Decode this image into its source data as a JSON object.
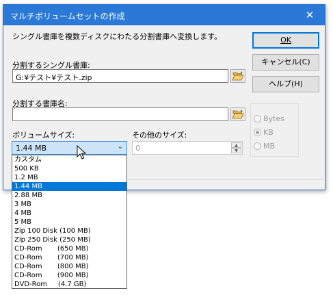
{
  "window": {
    "title": "マルチボリュームセットの作成",
    "close_glyph": "✕"
  },
  "instruction": "シングル書庫を複数ディスクにわたる分割書庫へ変換します。",
  "buttons": {
    "ok": "OK",
    "cancel": "キャンセル(C)",
    "help": "ヘルプ(H)"
  },
  "source": {
    "label": "分割するシングル書庫:",
    "value": "G:¥テスト¥テスト.zip"
  },
  "target": {
    "label": "分割する書庫名:",
    "value": ""
  },
  "volume_size": {
    "label": "ボリュームサイズ:",
    "selected": "1.44 MB",
    "options": [
      "カスタム",
      "500 KB",
      "1.2 MB",
      "1.44 MB",
      "2.88 MB",
      "3 MB",
      "4 MB",
      "5 MB",
      "Zip 100 Disk (100 MB)",
      "Zip 250 Disk (250 MB)",
      "CD-Rom       (650 MB)",
      "CD-Rom       (700 MB)",
      "CD-Rom       (800 MB)",
      "CD-Rom       (900 MB)",
      "DVD-Rom     (4.7 GB)"
    ],
    "selected_index": 3
  },
  "other_size": {
    "label": "その他のサイズ:",
    "value": "0"
  },
  "units": {
    "options": [
      "Bytes",
      "KB",
      "MB"
    ],
    "selected": "KB"
  },
  "colors": {
    "titlebar": "#2b79d6",
    "selection": "#0078d7"
  }
}
